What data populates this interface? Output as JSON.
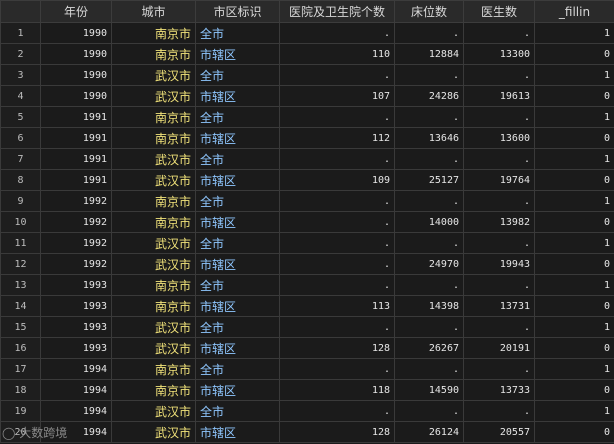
{
  "colors": {
    "city": "#f2e37a",
    "area": "#8fc7ff",
    "number": "#e6e6e6"
  },
  "headers": [
    "",
    "年份",
    "城市",
    "市区标识",
    "医院及卫生院个数",
    "床位数",
    "医生数",
    "_fillin"
  ],
  "rows": [
    [
      "1",
      "1990",
      "南京市",
      "全市",
      ".",
      ".",
      ".",
      "1"
    ],
    [
      "2",
      "1990",
      "南京市",
      "市辖区",
      "110",
      "12884",
      "13300",
      "0"
    ],
    [
      "3",
      "1990",
      "武汉市",
      "全市",
      ".",
      ".",
      ".",
      "1"
    ],
    [
      "4",
      "1990",
      "武汉市",
      "市辖区",
      "107",
      "24286",
      "19613",
      "0"
    ],
    [
      "5",
      "1991",
      "南京市",
      "全市",
      ".",
      ".",
      ".",
      "1"
    ],
    [
      "6",
      "1991",
      "南京市",
      "市辖区",
      "112",
      "13646",
      "13600",
      "0"
    ],
    [
      "7",
      "1991",
      "武汉市",
      "全市",
      ".",
      ".",
      ".",
      "1"
    ],
    [
      "8",
      "1991",
      "武汉市",
      "市辖区",
      "109",
      "25127",
      "19764",
      "0"
    ],
    [
      "9",
      "1992",
      "南京市",
      "全市",
      ".",
      ".",
      ".",
      "1"
    ],
    [
      "10",
      "1992",
      "南京市",
      "市辖区",
      ".",
      "14000",
      "13982",
      "0"
    ],
    [
      "11",
      "1992",
      "武汉市",
      "全市",
      ".",
      ".",
      ".",
      "1"
    ],
    [
      "12",
      "1992",
      "武汉市",
      "市辖区",
      ".",
      "24970",
      "19943",
      "0"
    ],
    [
      "13",
      "1993",
      "南京市",
      "全市",
      ".",
      ".",
      ".",
      "1"
    ],
    [
      "14",
      "1993",
      "南京市",
      "市辖区",
      "113",
      "14398",
      "13731",
      "0"
    ],
    [
      "15",
      "1993",
      "武汉市",
      "全市",
      ".",
      ".",
      ".",
      "1"
    ],
    [
      "16",
      "1993",
      "武汉市",
      "市辖区",
      "128",
      "26267",
      "20191",
      "0"
    ],
    [
      "17",
      "1994",
      "南京市",
      "全市",
      ".",
      ".",
      ".",
      "1"
    ],
    [
      "18",
      "1994",
      "南京市",
      "市辖区",
      "118",
      "14590",
      "13733",
      "0"
    ],
    [
      "19",
      "1994",
      "武汉市",
      "全市",
      ".",
      ".",
      ".",
      "1"
    ],
    [
      "20",
      "1994",
      "武汉市",
      "市辖区",
      "128",
      "26124",
      "20557",
      "0"
    ]
  ],
  "watermark": "大数跨境"
}
